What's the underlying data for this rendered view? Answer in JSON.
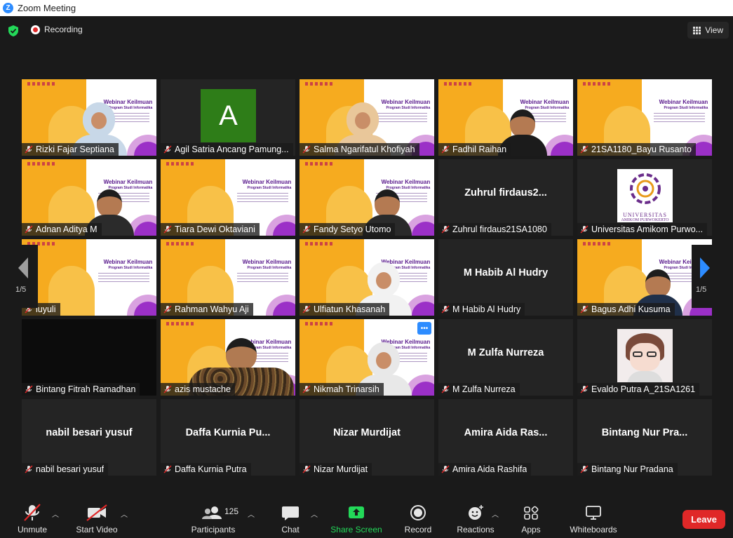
{
  "window": {
    "title": "Zoom Meeting",
    "logo_letter": "Z"
  },
  "topbar": {
    "recording_label": "Recording",
    "view_label": "View"
  },
  "pager": {
    "left": "1/5",
    "right": "1/5"
  },
  "tiles": [
    {
      "name": "Rizki Fajar Septiana"
    },
    {
      "name": "Agil Satria Ancang Pamung...",
      "avatar_letter": "A"
    },
    {
      "name": "Salma Ngarifatul Khofiyah"
    },
    {
      "name": "Fadhil Raihan"
    },
    {
      "name": "21SA1180_Bayu Rusanto"
    },
    {
      "name": "Adnan Aditya M"
    },
    {
      "name": "Tiara Dewi Oktaviani"
    },
    {
      "name": "Fandy Setyo Utomo"
    },
    {
      "name": "Zuhrul firdaus21SA1080",
      "big": "Zuhrul  firdaus2..."
    },
    {
      "name": "Universitas Amikom Purwo...",
      "logo_top": "UNIVERSITAS",
      "logo_bottom": "AMIKOM PURWOKERTO"
    },
    {
      "name": "luyuli"
    },
    {
      "name": "Rahman Wahyu Aji"
    },
    {
      "name": "Ulfiatun Khasanah"
    },
    {
      "name": "M Habib Al Hudry",
      "big": "M Habib Al Hudry"
    },
    {
      "name": "Bagus Adhi Kusuma"
    },
    {
      "name": "Bintang Fitrah Ramadhan"
    },
    {
      "name": "azis mustache"
    },
    {
      "name": "Nikmah Trinarsih"
    },
    {
      "name": "M Zulfa Nurreza",
      "big": "M Zulfa Nurreza"
    },
    {
      "name": "Evaldo Putra A_21SA1261"
    },
    {
      "name": "nabil besari yusuf",
      "big": "nabil besari yusuf"
    },
    {
      "name": "Daffa Kurnia Putra",
      "big": "Daffa  Kurnia  Pu..."
    },
    {
      "name": "Nizar Murdijat",
      "big": "Nizar Murdijat"
    },
    {
      "name": "Amira Aida Rashifa",
      "big": "Amira  Aida  Ras..."
    },
    {
      "name": "Bintang Nur Pradana",
      "big": "Bintang  Nur  Pra..."
    }
  ],
  "slide": {
    "title": "Webinar Keilmuan",
    "subtitle": "Program Studi Informatika"
  },
  "toolbar": {
    "unmute": "Unmute",
    "start_video": "Start Video",
    "participants": "Participants",
    "participants_count": "125",
    "chat": "Chat",
    "share_screen": "Share Screen",
    "record": "Record",
    "reactions": "Reactions",
    "apps": "Apps",
    "whiteboards": "Whiteboards",
    "leave": "Leave"
  },
  "colors": {
    "share_green": "#23d959",
    "leave_red": "#e02828",
    "active_speaker": "#e6e88a"
  }
}
